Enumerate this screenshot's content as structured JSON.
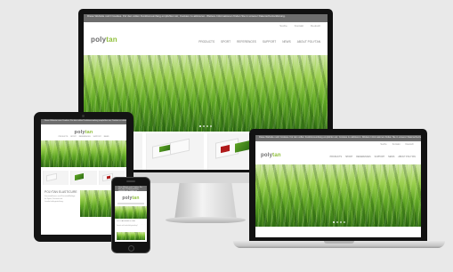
{
  "site": {
    "logo": "polytan",
    "cookie_notice": "Diese Website nutzt Cookies. Für den vollen Funktionsumfang empfehlen wir, Cookies zu aktivieren. Weitere Informationen finden Sie in unserer Datenschutzerklärung.",
    "top_links": [
      "Suche",
      "Kontakt",
      "Deutsch"
    ],
    "nav": [
      "Products",
      "Sport",
      "References",
      "Support",
      "News",
      "About Polytan"
    ],
    "mobile_heading": "POLYTAN ELASTICURE",
    "mobile_text": "Kunststoffrasen und Kunststoffbeläge für Sport, Freizeit und Landschaftsgestaltung."
  },
  "slider": {
    "total": 4,
    "active": 1
  },
  "colors": {
    "logo": "#6b6b6b",
    "accent": "#8fbf3a",
    "grass_dark": "#2f6e14",
    "grass_light": "#9bd04e",
    "background": "#e9e9e9"
  },
  "devices": [
    "imac",
    "macbook",
    "ipad",
    "iphone"
  ]
}
